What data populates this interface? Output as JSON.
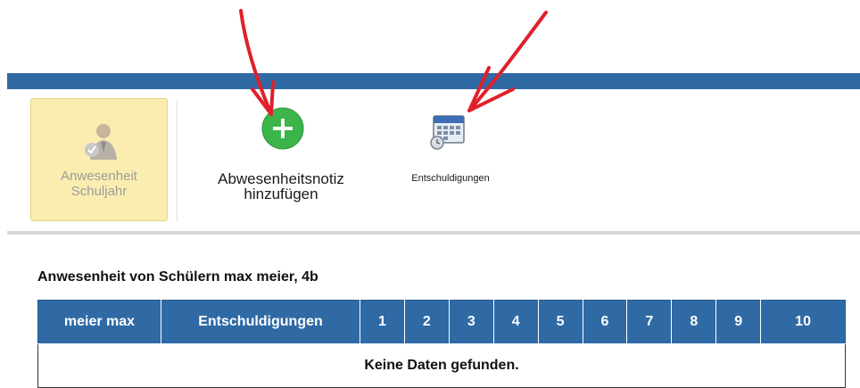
{
  "toolbar": {
    "attendance_year_label": "Anwesenheit Schuljahr",
    "add_absence_note_label": "Abwesenheitsnotiz hinzufügen",
    "excuses_label": "Entschuldigungen"
  },
  "main": {
    "heading": "Anwesenheit von Schülern max meier, 4b",
    "table": {
      "columns": [
        "meier max",
        "Entschuldigungen",
        "1",
        "2",
        "3",
        "4",
        "5",
        "6",
        "7",
        "8",
        "9",
        "10"
      ],
      "empty_message": "Keine Daten gefunden."
    }
  },
  "colors": {
    "header_blue": "#2f6aa5",
    "add_green": "#3bb54a",
    "annotation_red": "#e0202a",
    "active_tool_bg": "#fbedb0"
  },
  "icons": [
    "user-check-icon",
    "plus-circle-icon",
    "calendar-icon"
  ]
}
